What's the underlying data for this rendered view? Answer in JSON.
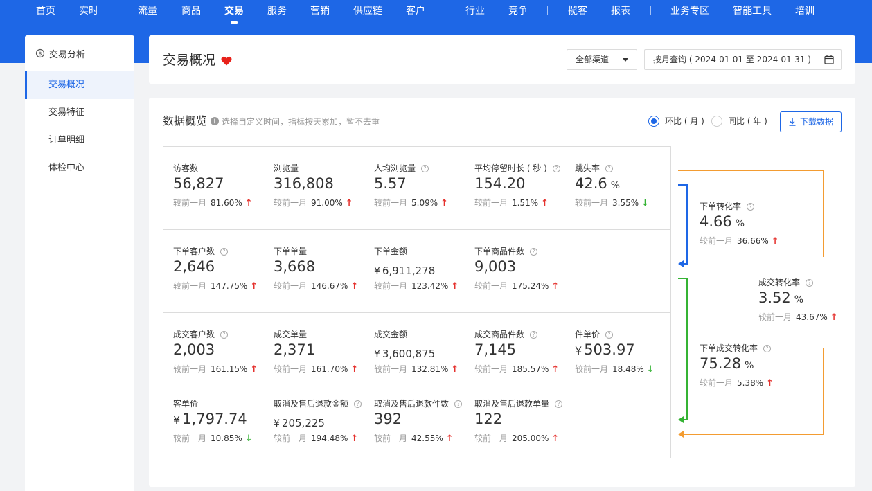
{
  "nav": {
    "items": [
      {
        "label": "首页"
      },
      {
        "label": "实时"
      },
      {
        "label": "流量"
      },
      {
        "label": "商品"
      },
      {
        "label": "交易"
      },
      {
        "label": "服务"
      },
      {
        "label": "营销"
      },
      {
        "label": "供应链"
      },
      {
        "label": "客户"
      },
      {
        "label": "行业"
      },
      {
        "label": "竞争"
      },
      {
        "label": "揽客"
      },
      {
        "label": "报表"
      },
      {
        "label": "业务专区"
      },
      {
        "label": "智能工具"
      },
      {
        "label": "培训"
      }
    ],
    "active": "交易"
  },
  "sidebar": {
    "header": "交易分析",
    "items": [
      {
        "label": "交易概况",
        "active": true
      },
      {
        "label": "交易特征"
      },
      {
        "label": "订单明细"
      },
      {
        "label": "体检中心"
      }
    ]
  },
  "header": {
    "title": "交易概况",
    "channel_select": "全部渠道",
    "date_range": "按月查询 ( 2024-01-01 至 2024-01-31 )"
  },
  "overview": {
    "title": "数据概览",
    "hint": "选择自定义时间，指标按天累加，暂不去重",
    "radio_mom": "环比 ( 月 )",
    "radio_yoy": "同比 ( 年 )",
    "download_label": "下载数据",
    "compare_label": "较前一月",
    "metrics": {
      "visitors": {
        "label": "访客数",
        "value": "56,827",
        "change": "81.60%",
        "dir": "up"
      },
      "pageviews": {
        "label": "浏览量",
        "value": "316,808",
        "change": "91.00%",
        "dir": "up"
      },
      "avg_pv": {
        "label": "人均浏览量",
        "value": "5.57",
        "change": "5.09%",
        "dir": "up"
      },
      "avg_stay": {
        "label": "平均停留时长 ( 秒 )",
        "value": "154.20",
        "change": "1.51%",
        "dir": "up"
      },
      "bounce": {
        "label": "跳失率",
        "value": "42.6",
        "unit": "%",
        "change": "3.55%",
        "dir": "down"
      },
      "order_customers": {
        "label": "下单客户数",
        "value": "2,646",
        "change": "147.75%",
        "dir": "up"
      },
      "order_count": {
        "label": "下单单量",
        "value": "3,668",
        "change": "146.67%",
        "dir": "up"
      },
      "order_amount": {
        "label": "下单金额",
        "currency": "¥",
        "value": "6,911,278",
        "change": "123.42%",
        "dir": "up"
      },
      "order_items": {
        "label": "下单商品件数",
        "value": "9,003",
        "change": "175.24%",
        "dir": "up"
      },
      "deal_customers": {
        "label": "成交客户数",
        "value": "2,003",
        "change": "161.15%",
        "dir": "up"
      },
      "deal_count": {
        "label": "成交单量",
        "value": "2,371",
        "change": "161.70%",
        "dir": "up"
      },
      "deal_amount": {
        "label": "成交金额",
        "currency": "¥",
        "value": "3,600,875",
        "change": "132.81%",
        "dir": "up"
      },
      "deal_items": {
        "label": "成交商品件数",
        "value": "7,145",
        "change": "185.57%",
        "dir": "up"
      },
      "unit_price": {
        "label": "件单价",
        "currency": "¥",
        "value": "503.97",
        "change": "18.48%",
        "dir": "down"
      },
      "customer_price": {
        "label": "客单价",
        "currency": "¥",
        "value": "1,797.74",
        "change": "10.85%",
        "dir": "down"
      },
      "refund_amount": {
        "label": "取消及售后退款金额",
        "currency": "¥",
        "value": "205,225",
        "change": "194.48%",
        "dir": "up"
      },
      "refund_items": {
        "label": "取消及售后退款件数",
        "value": "392",
        "change": "42.55%",
        "dir": "up"
      },
      "refund_orders": {
        "label": "取消及售后退款单量",
        "value": "122",
        "change": "205.00%",
        "dir": "up"
      },
      "order_conv": {
        "label": "下单转化率",
        "value": "4.66",
        "unit": "%",
        "change": "36.66%",
        "dir": "up"
      },
      "deal_conv": {
        "label": "成交转化率",
        "value": "3.52",
        "unit": "%",
        "change": "43.67%",
        "dir": "up"
      },
      "order_deal_conv": {
        "label": "下单成交转化率",
        "value": "75.28",
        "unit": "%",
        "change": "5.38%",
        "dir": "up"
      }
    }
  },
  "colors": {
    "brand": "#1e67e6",
    "up": "#e5322e",
    "down": "#35b334",
    "funnel_orange": "#f39c32",
    "funnel_blue": "#1e67e6",
    "funnel_green": "#35b334"
  }
}
